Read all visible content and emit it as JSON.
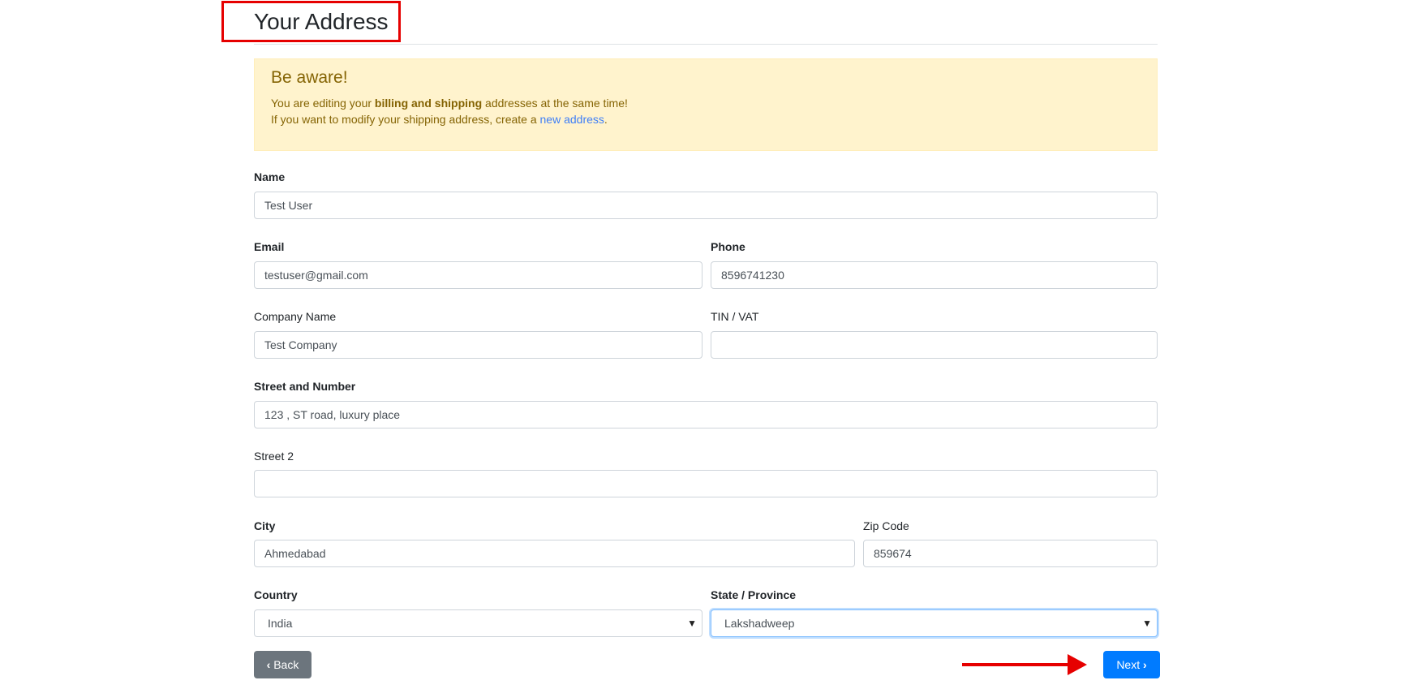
{
  "title": "Your Address",
  "alert": {
    "heading": "Be aware!",
    "line1_pre": "You are editing your ",
    "line1_bold": "billing and shipping",
    "line1_post": " addresses at the same time!",
    "line2_pre": "If you want to modify your shipping address, create a ",
    "line2_link": "new address",
    "line2_post": "."
  },
  "form": {
    "name": {
      "label": "Name",
      "value": "Test User"
    },
    "email": {
      "label": "Email",
      "value": "testuser@gmail.com"
    },
    "phone": {
      "label": "Phone",
      "value": "8596741230"
    },
    "company": {
      "label": "Company Name",
      "value": "Test Company"
    },
    "vat": {
      "label": "TIN / VAT",
      "value": ""
    },
    "street": {
      "label": "Street and Number",
      "value": "123 , ST road, luxury place"
    },
    "street2": {
      "label": "Street 2",
      "value": ""
    },
    "city": {
      "label": "City",
      "value": "Ahmedabad"
    },
    "zip": {
      "label": "Zip Code",
      "value": "859674"
    },
    "country": {
      "label": "Country",
      "value": "India"
    },
    "state": {
      "label": "State / Province",
      "value": "Lakshadweep"
    }
  },
  "buttons": {
    "back": "Back",
    "next": "Next"
  },
  "icons": {
    "back": "chevron-left-icon",
    "next": "chevron-right-icon",
    "select_caret": "caret-down-icon"
  },
  "colors": {
    "annotation": "#e60000",
    "primary": "#007bff",
    "secondary": "#6c757d",
    "alert_bg": "#fff3cd"
  }
}
